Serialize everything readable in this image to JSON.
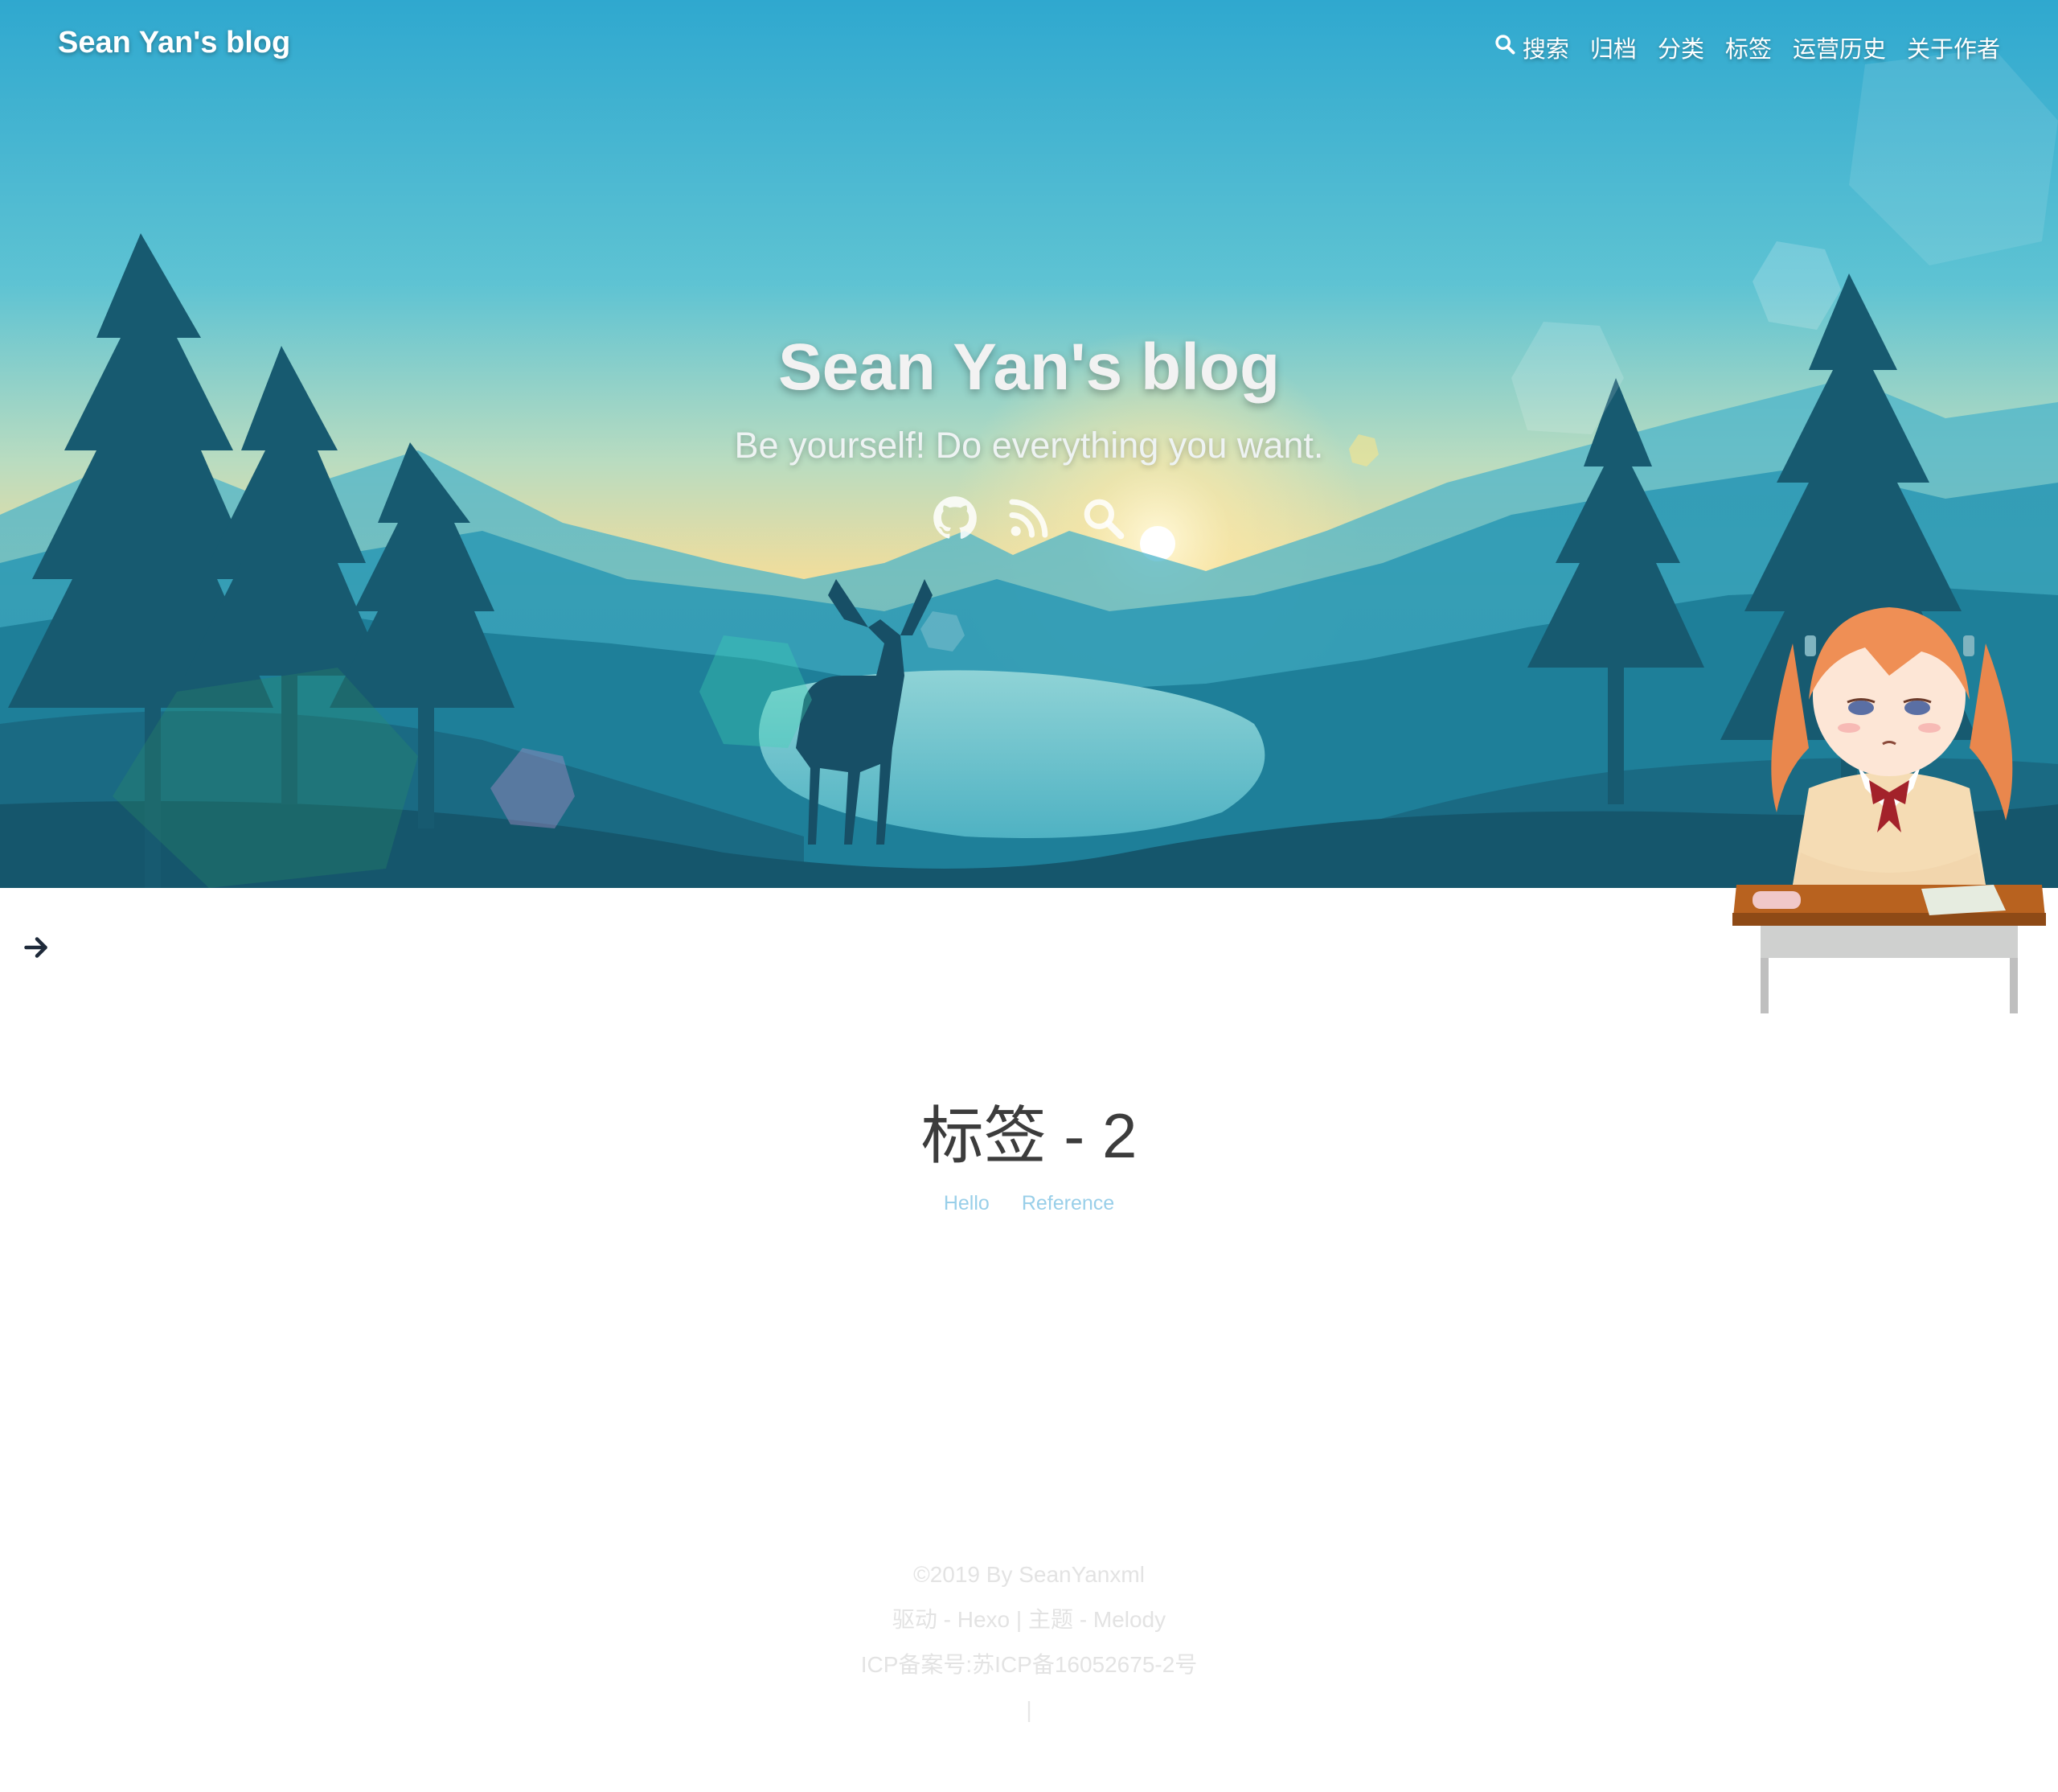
{
  "header": {
    "site_name": "Sean Yan's blog",
    "menu": [
      {
        "label": "搜索",
        "icon": "search-icon"
      },
      {
        "label": "归档"
      },
      {
        "label": "分类"
      },
      {
        "label": "标签"
      },
      {
        "label": "运营历史"
      },
      {
        "label": "关于作者"
      }
    ]
  },
  "hero": {
    "title": "Sean Yan's blog",
    "subtitle": "Be yourself! Do everything you want.",
    "social_icons": [
      "github-icon",
      "rss-icon",
      "search-icon"
    ]
  },
  "sidebar_toggle": {
    "icon": "arrow-right-icon"
  },
  "main": {
    "title": "标签 - 2",
    "tags": [
      "Hello",
      "Reference"
    ],
    "tag_color": "#99cfe9"
  },
  "footer": {
    "copyright": "©2019 By SeanYanxml",
    "powered_prefix": "驱动 - ",
    "powered_engine": "Hexo",
    "divider": " | ",
    "theme_prefix": "主题 - ",
    "theme_name": "Melody",
    "icp": "ICP备案号:苏ICP备16052675-2号",
    "separator": "|"
  },
  "colors": {
    "sky_top": "#30a9d0",
    "sky_bottom": "#f4dc9a",
    "forest": "#17566c",
    "title_text": "#3c3c3c",
    "footer_text": "#e3e3e3"
  }
}
